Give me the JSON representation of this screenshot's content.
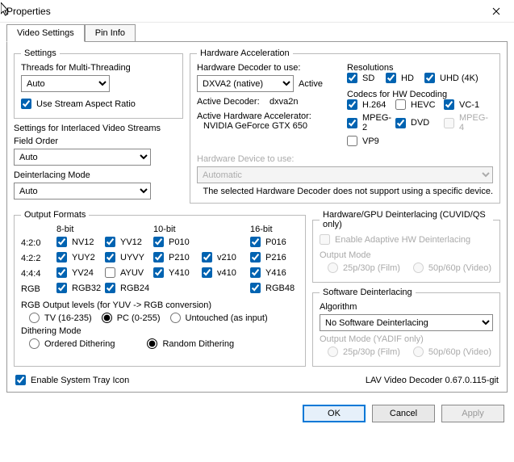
{
  "window": {
    "title": "Properties"
  },
  "tabs": [
    "Video Settings",
    "Pin Info"
  ],
  "settings": {
    "legend": "Settings",
    "threads_label": "Threads for Multi-Threading",
    "threads_value": "Auto",
    "use_stream_ar": "Use Stream Aspect Ratio",
    "interlaced_label": "Settings for Interlaced Video Streams",
    "field_order_label": "Field Order",
    "field_order_value": "Auto",
    "deint_mode_label": "Deinterlacing Mode",
    "deint_mode_value": "Auto"
  },
  "hw": {
    "legend": "Hardware Acceleration",
    "decoder_to_use": "Hardware Decoder to use:",
    "decoder_value": "DXVA2 (native)",
    "active": "Active",
    "active_dec_lbl": "Active Decoder:",
    "active_dec_val": "dxva2n",
    "active_hw_lbl": "Active Hardware Accelerator:",
    "active_hw_val": "NVIDIA GeForce GTX 650",
    "device_lbl": "Hardware Device to use:",
    "device_val": "Automatic",
    "device_note": "The selected Hardware Decoder does not support using a specific device.",
    "res_lbl": "Resolutions",
    "res": {
      "sd": "SD",
      "hd": "HD",
      "uhd": "UHD (4K)"
    },
    "codecs_lbl": "Codecs for HW Decoding",
    "codecs": {
      "h264": "H.264",
      "hevc": "HEVC",
      "vc1": "VC-1",
      "mpeg2": "MPEG-2",
      "dvd": "DVD",
      "mpeg4": "MPEG-4",
      "vp9": "VP9"
    }
  },
  "outfmt": {
    "legend": "Output Formats",
    "h8": "8-bit",
    "h10": "10-bit",
    "h16": "16-bit",
    "r420": "4:2:0",
    "r422": "4:2:2",
    "r444": "4:4:4",
    "rrgb": "RGB",
    "nv12": "NV12",
    "yv12": "YV12",
    "p010": "P010",
    "p016": "P016",
    "yuy2": "YUY2",
    "uyvy": "UYVY",
    "p210": "P210",
    "v210": "v210",
    "p216": "P216",
    "yv24": "YV24",
    "ayuv": "AYUV",
    "y410": "Y410",
    "v410": "v410",
    "y416": "Y416",
    "rgb32": "RGB32",
    "rgb24": "RGB24",
    "rgb48": "RGB48",
    "rgb_levels_lbl": "RGB Output levels (for YUV -> RGB conversion)",
    "tv": "TV (16-235)",
    "pc": "PC (0-255)",
    "untouched": "Untouched (as input)",
    "dither_lbl": "Dithering Mode",
    "ordered": "Ordered Dithering",
    "random": "Random Dithering"
  },
  "hwdeint": {
    "legend": "Hardware/GPU Deinterlacing (CUVID/QS only)",
    "adaptive": "Enable Adaptive HW Deinterlacing",
    "out_mode": "Output Mode",
    "film": "25p/30p (Film)",
    "video": "50p/60p (Video)"
  },
  "swdeint": {
    "legend": "Software Deinterlacing",
    "algo_lbl": "Algorithm",
    "algo_val": "No Software Deinterlacing",
    "out_mode": "Output Mode (YADIF only)",
    "film": "25p/30p (Film)",
    "video": "50p/60p (Video)"
  },
  "systray": "Enable System Tray Icon",
  "version": "LAV Video Decoder 0.67.0.115-git",
  "buttons": {
    "ok": "OK",
    "cancel": "Cancel",
    "apply": "Apply"
  }
}
